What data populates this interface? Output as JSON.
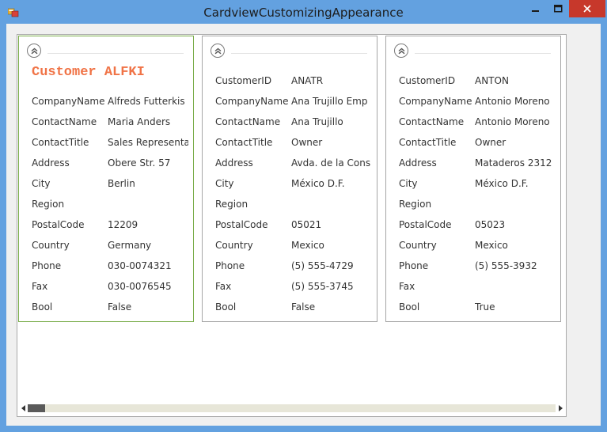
{
  "window": {
    "title": "CardviewCustomizingAppearance"
  },
  "title_controls": {
    "minimize": "–",
    "maximize": "□",
    "close": "✕"
  },
  "colors": {
    "caption": "#f07346",
    "focused_border": "#7aad4a",
    "close_bg": "#c7382b"
  },
  "cards": [
    {
      "caption": "Customer ALFKI",
      "focused": true,
      "fields": [
        {
          "name": "CompanyName",
          "value": "Alfreds Futterkis"
        },
        {
          "name": "ContactName",
          "value": "Maria Anders"
        },
        {
          "name": "ContactTitle",
          "value": "Sales Representa"
        },
        {
          "name": "Address",
          "value": "Obere Str. 57"
        },
        {
          "name": "City",
          "value": "Berlin"
        },
        {
          "name": "Region",
          "value": ""
        },
        {
          "name": "PostalCode",
          "value": "12209"
        },
        {
          "name": "Country",
          "value": "Germany"
        },
        {
          "name": "Phone",
          "value": "030-0074321"
        },
        {
          "name": "Fax",
          "value": "030-0076545"
        },
        {
          "name": "Bool",
          "value": "False"
        }
      ]
    },
    {
      "caption": "",
      "focused": false,
      "fields": [
        {
          "name": "CustomerID",
          "value": "ANATR"
        },
        {
          "name": "CompanyName",
          "value": "Ana Trujillo Emp"
        },
        {
          "name": "ContactName",
          "value": "Ana Trujillo"
        },
        {
          "name": "ContactTitle",
          "value": "Owner"
        },
        {
          "name": "Address",
          "value": "Avda. de la Cons"
        },
        {
          "name": "City",
          "value": "México D.F."
        },
        {
          "name": "Region",
          "value": ""
        },
        {
          "name": "PostalCode",
          "value": "05021"
        },
        {
          "name": "Country",
          "value": "Mexico"
        },
        {
          "name": "Phone",
          "value": "(5) 555-4729"
        },
        {
          "name": "Fax",
          "value": "(5) 555-3745"
        },
        {
          "name": "Bool",
          "value": "False"
        }
      ]
    },
    {
      "caption": "",
      "focused": false,
      "fields": [
        {
          "name": "CustomerID",
          "value": "ANTON"
        },
        {
          "name": "CompanyName",
          "value": "Antonio Moreno"
        },
        {
          "name": "ContactName",
          "value": "Antonio Moreno"
        },
        {
          "name": "ContactTitle",
          "value": "Owner"
        },
        {
          "name": "Address",
          "value": "Mataderos  2312"
        },
        {
          "name": "City",
          "value": "México D.F."
        },
        {
          "name": "Region",
          "value": ""
        },
        {
          "name": "PostalCode",
          "value": "05023"
        },
        {
          "name": "Country",
          "value": "Mexico"
        },
        {
          "name": "Phone",
          "value": "(5) 555-3932"
        },
        {
          "name": "Fax",
          "value": ""
        },
        {
          "name": "Bool",
          "value": "True"
        }
      ]
    }
  ]
}
